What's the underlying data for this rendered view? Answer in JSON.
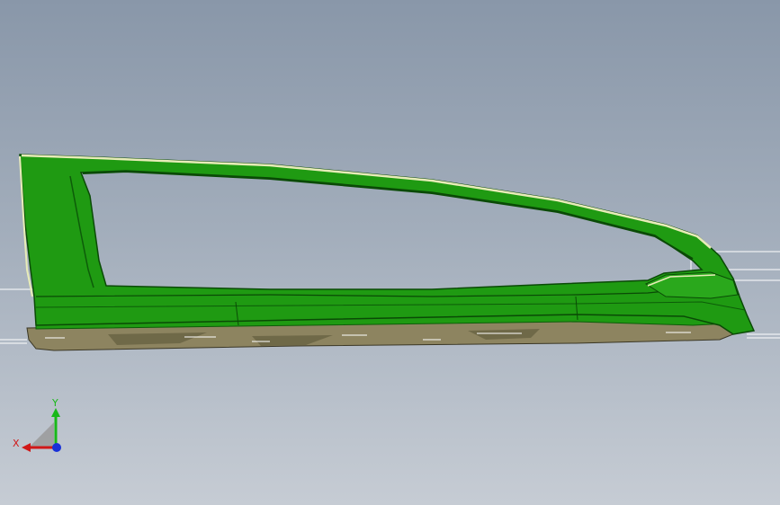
{
  "viewport": {
    "background_top": "#8997a9",
    "background_bottom": "#c6ccd4"
  },
  "model": {
    "frame_color": "#1f9a12",
    "frame_dark": "#0d5c09",
    "frame_highlight": "#e8ecb8",
    "sill_color": "#8d8460",
    "sill_dark": "#5c5638"
  },
  "triad": {
    "x_label": "X",
    "y_label": "Y",
    "x_color": "#d01818",
    "y_color": "#18b818",
    "z_color": "#1830d8"
  }
}
